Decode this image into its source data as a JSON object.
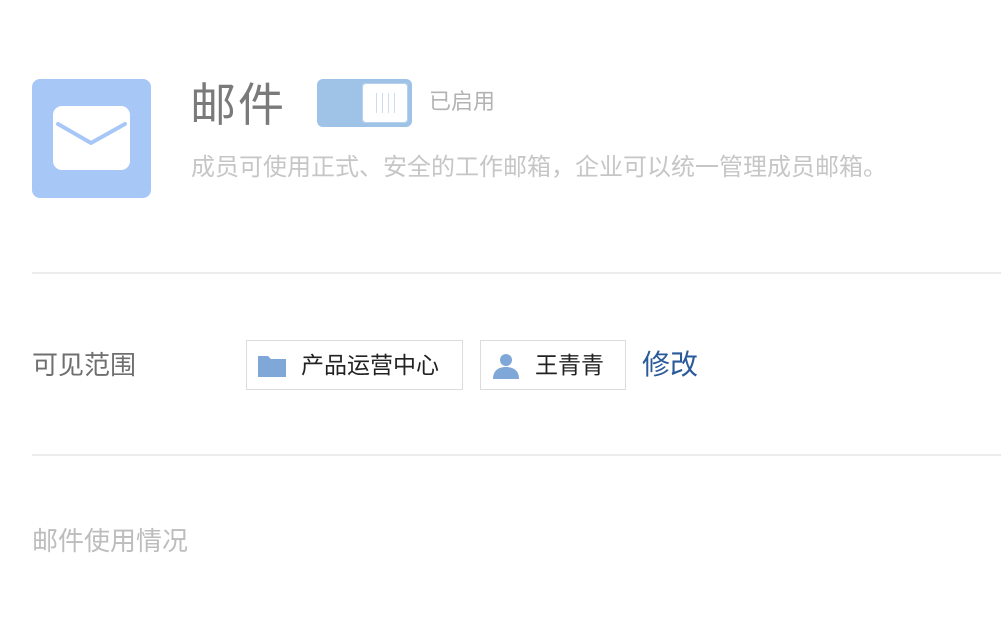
{
  "app": {
    "title": "邮件",
    "status": "已启用",
    "enabled": true,
    "description": "成员可使用正式、安全的工作邮箱，企业可以统一管理成员邮箱。",
    "icon": "mail-icon",
    "icon_color": "#a7c8f7"
  },
  "visibility": {
    "label": "可见范围",
    "items": [
      {
        "type": "department",
        "icon": "folder-icon",
        "name": "产品运营中心"
      },
      {
        "type": "user",
        "icon": "user-icon",
        "name": "王青青"
      }
    ],
    "edit_label": "修改",
    "link_color": "#2a5a9a"
  },
  "usage": {
    "title": "邮件使用情况"
  }
}
